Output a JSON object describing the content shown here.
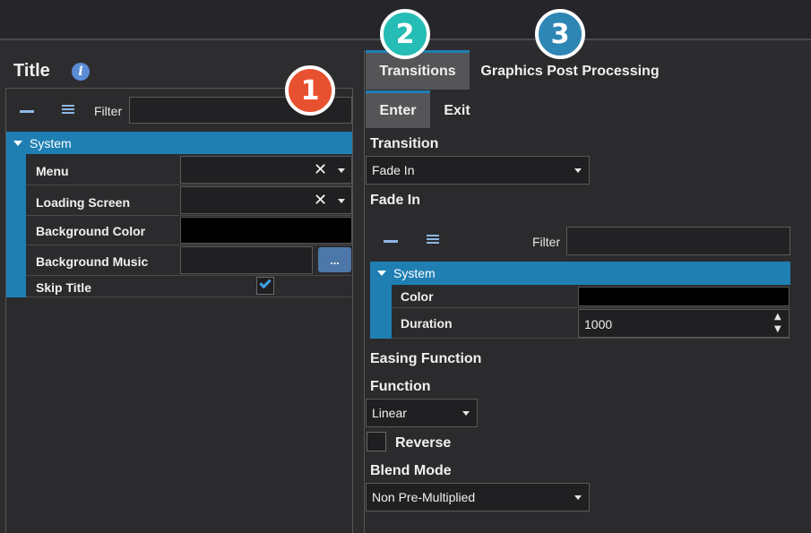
{
  "callouts": {
    "one": "1",
    "two": "2",
    "three": "3"
  },
  "left": {
    "title": "Title",
    "info_icon": "i",
    "filter_label": "Filter",
    "filter_value": "",
    "section": "System",
    "rows": [
      {
        "label": "Menu"
      },
      {
        "label": "Loading Screen"
      },
      {
        "label": "Background Color"
      },
      {
        "label": "Background Music",
        "browse_label": "..."
      },
      {
        "label": "Skip Title",
        "checked": true
      }
    ],
    "clear_glyph": "✕"
  },
  "right": {
    "tabs": [
      "Transitions",
      "Graphics Post Processing"
    ],
    "subtabs": [
      "Enter",
      "Exit"
    ],
    "transition_heading": "Transition",
    "transition_value": "Fade In",
    "fade_heading": "Fade In",
    "filter_label": "Filter",
    "section": "System",
    "color_label": "Color",
    "duration_label": "Duration",
    "duration_value": "1000",
    "easing_heading": "Easing Function",
    "function_heading": "Function",
    "function_value": "Linear",
    "reverse_label": "Reverse",
    "reverse_checked": false,
    "blend_heading": "Blend Mode",
    "blend_value": "Non Pre-Multiplied"
  },
  "colors": {
    "accent": "#1f7fb3",
    "callout1": "#e8512f",
    "callout2": "#25bdb5",
    "callout3": "#2e86b5"
  }
}
